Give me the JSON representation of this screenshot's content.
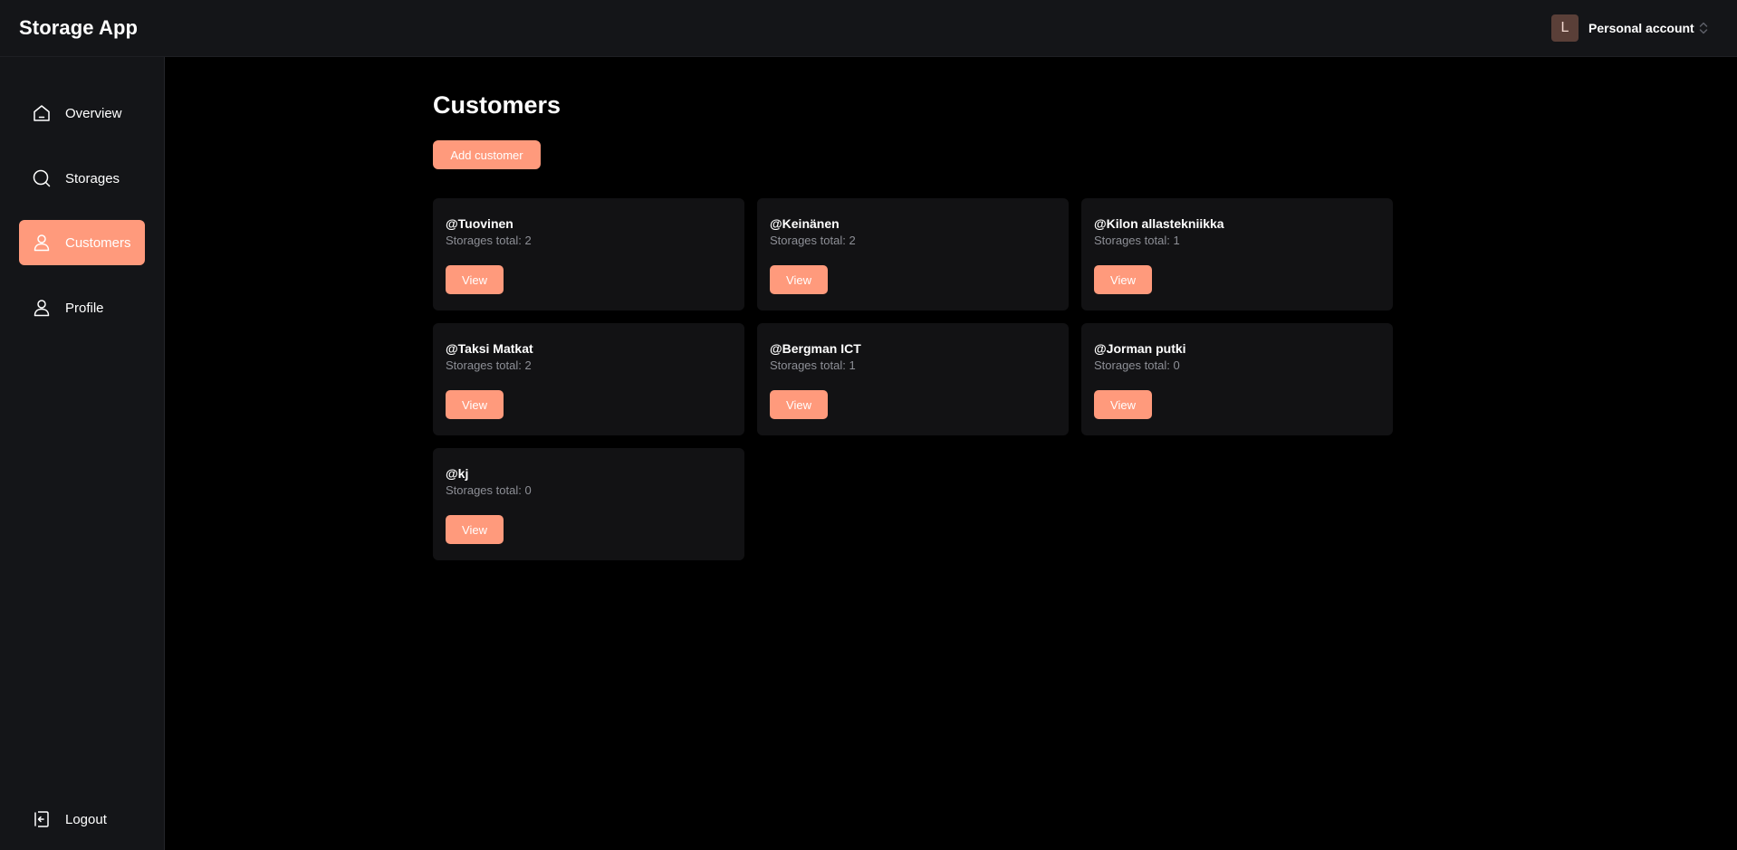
{
  "header": {
    "app_title": "Storage App",
    "account": {
      "avatar_letter": "L",
      "label": "Personal account"
    }
  },
  "sidebar": {
    "items": [
      {
        "label": "Overview",
        "icon": "home-icon",
        "active": false
      },
      {
        "label": "Storages",
        "icon": "search-icon",
        "active": false
      },
      {
        "label": "Customers",
        "icon": "user-icon",
        "active": true
      },
      {
        "label": "Profile",
        "icon": "user-icon",
        "active": false
      }
    ],
    "logout": {
      "label": "Logout",
      "icon": "logout-icon"
    }
  },
  "main": {
    "title": "Customers",
    "add_button_label": "Add customer",
    "customers": [
      {
        "name": "@Tuovinen",
        "storages": "Storages total: 2",
        "view_label": "View"
      },
      {
        "name": "@Keinänen",
        "storages": "Storages total: 2",
        "view_label": "View"
      },
      {
        "name": "@Kilon allastekniikka",
        "storages": "Storages total: 1",
        "view_label": "View"
      },
      {
        "name": "@Taksi Matkat",
        "storages": "Storages total: 2",
        "view_label": "View"
      },
      {
        "name": "@Bergman ICT",
        "storages": "Storages total: 1",
        "view_label": "View"
      },
      {
        "name": "@Jorman putki",
        "storages": "Storages total: 0",
        "view_label": "View"
      },
      {
        "name": "@kj",
        "storages": "Storages total: 0",
        "view_label": "View"
      }
    ]
  },
  "colors": {
    "accent": "#ff9a7c",
    "panel": "#141518",
    "card": "#121214",
    "muted_text": "#8d8f96"
  }
}
